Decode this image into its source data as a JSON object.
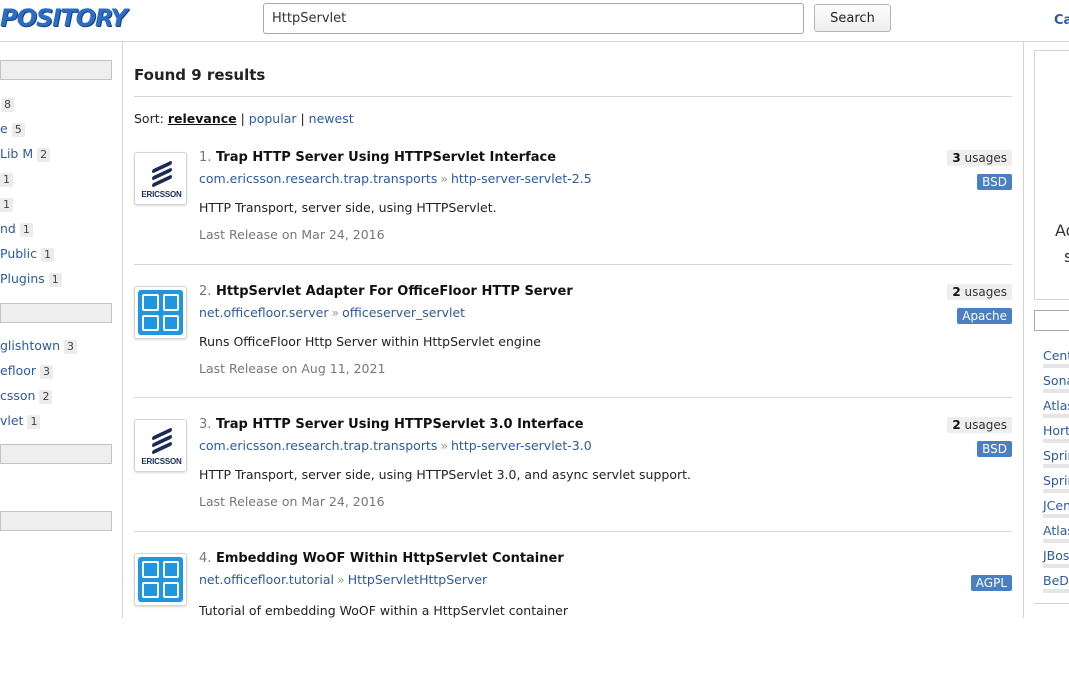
{
  "header": {
    "logo_text": "POSITORY",
    "search_value": "HttpServlet",
    "search_button": "Search",
    "right_link": "Ca"
  },
  "left_sidebar": {
    "group1": [
      {
        "label": "",
        "count": "8"
      },
      {
        "label": "e",
        "count": "5"
      },
      {
        "label": "Lib M",
        "count": "2"
      },
      {
        "label": "",
        "count": "1"
      },
      {
        "label": "",
        "count": "1"
      },
      {
        "label": "nd",
        "count": "1"
      },
      {
        "label": " Public",
        "count": "1"
      },
      {
        "label": "Plugins",
        "count": "1"
      }
    ],
    "group2": [
      {
        "label": "glishtown",
        "count": "3"
      },
      {
        "label": "efloor",
        "count": "3"
      },
      {
        "label": "csson",
        "count": "2"
      },
      {
        "label": "vlet",
        "count": "1"
      }
    ]
  },
  "main": {
    "found_text": "Found 9 results",
    "sort_label": "Sort:",
    "sort_options": [
      "relevance",
      "popular",
      "newest"
    ],
    "results": [
      {
        "num": "1.",
        "title": "Trap HTTP Server Using HTTPServlet Interface",
        "group": "com.ericsson.research.trap.transports",
        "artifact": "http-server-servlet-2.5",
        "description": "HTTP Transport, server side, using HTTPServlet.",
        "release": "Last Release on Mar 24, 2016",
        "usages_num": "3",
        "usages_label": "usages",
        "license": "BSD",
        "logo": "ericsson-logo",
        "logo_text": "ERICSSON"
      },
      {
        "num": "2.",
        "title": "HttpServlet Adapter For OfficeFloor HTTP Server",
        "group": "net.officefloor.server",
        "artifact": "officeserver_servlet",
        "description": "Runs OfficeFloor Http Server within HttpServlet engine",
        "release": "Last Release on Aug 11, 2021",
        "usages_num": "2",
        "usages_label": "usages",
        "license": "Apache",
        "logo": "officefloor-logo"
      },
      {
        "num": "3.",
        "title": "Trap HTTP Server Using HTTPServlet 3.0 Interface",
        "group": "com.ericsson.research.trap.transports",
        "artifact": "http-server-servlet-3.0",
        "description": "HTTP Transport, server side, using HTTPServlet 3.0, and async servlet support.",
        "release": "Last Release on Mar 24, 2016",
        "usages_num": "2",
        "usages_label": "usages",
        "license": "BSD",
        "logo": "ericsson-logo",
        "logo_text": "ERICSSON"
      },
      {
        "num": "4.",
        "title": "Embedding WoOF Within HttpServlet Container",
        "group": "net.officefloor.tutorial",
        "artifact": "HttpServletHttpServer",
        "description": "Tutorial of embedding WoOF within a HttpServlet container",
        "license": "AGPL",
        "logo": "officefloor-logo"
      }
    ],
    "separator": "»"
  },
  "right_sidebar": {
    "ad_text_1": "Ad",
    "ad_text_2": "s",
    "repos": [
      "Cent",
      "Sona",
      "Atlas",
      "Hort",
      "Sprin",
      "Sprin",
      "JCen",
      "Atlas",
      "JBos",
      "BeDa"
    ]
  }
}
